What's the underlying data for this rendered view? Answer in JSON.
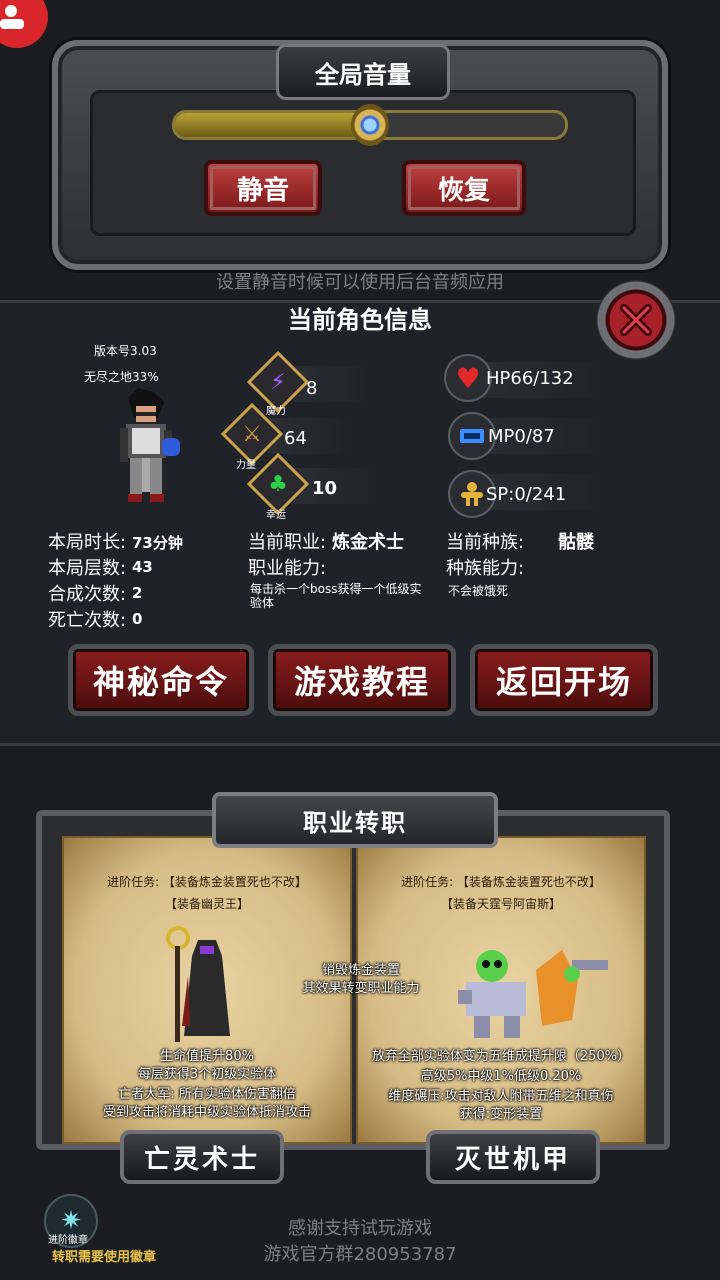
{
  "volume": {
    "title": "全局音量",
    "level_fraction": 0.5,
    "mute_label": "静音",
    "restore_label": "恢复",
    "hint": "设置静音时候可以使用后台音频应用"
  },
  "info": {
    "title": "当前角色信息",
    "version": "版本号3.03",
    "mode": "无尽之地33%",
    "stats": {
      "magic": {
        "label": "魔力",
        "value": "8"
      },
      "power": {
        "label": "力量",
        "value": "64"
      },
      "luck": {
        "label": "幸运",
        "value": "10"
      }
    },
    "hp": "HP66/132",
    "mp": "MP0/87",
    "sp": "SP:0/241",
    "left_rows": [
      {
        "label": "本局时长:",
        "value": "73分钟"
      },
      {
        "label": "本局层数:",
        "value": "43"
      },
      {
        "label": "合成次数:",
        "value": "2"
      },
      {
        "label": "死亡次数:",
        "value": "0"
      }
    ],
    "job_label": "当前职业:",
    "job_value": "炼金术士",
    "job_ability_label": "职业能力:",
    "job_ability_desc": "每击杀一个boss获得一个低级实验体",
    "race_label": "当前种族:",
    "race_value": "骷髅",
    "race_ability_label": "种族能力:",
    "race_ability_desc": "不会被饿死"
  },
  "buttons": {
    "secret": "神秘命令",
    "tutorial": "游戏教程",
    "back": "返回开场"
  },
  "class_change": {
    "title": "职业转职",
    "center_note_1": "销毁炼金装置",
    "center_note_2": "其效果转变职业能力",
    "left": {
      "task_1": "进阶任务: 【装备炼金装置死也不改】",
      "task_2": "【装备幽灵王】",
      "lines": [
        "生命值提升80%",
        "每层获得3个初级实验体",
        "亡者大军: 所有实验体伤害翻倍",
        "受到攻击将消耗中级实验体抵消攻击"
      ],
      "name": "亡灵术士"
    },
    "right": {
      "task_1": "进阶任务: 【装备炼金装置死也不改】",
      "task_2": "【装备天霆号阿宙斯】",
      "lines": [
        "放弃全部实验体变为五维成提升限（250%）",
        "高级5%中级1%低级0.20%",
        "维度碾压:攻击对敌人附带五维之和真伤",
        "获得:变形装置"
      ],
      "name": "灭世机甲"
    }
  },
  "badge": {
    "label": "进阶徽章",
    "note": "转职需要使用徽章"
  },
  "footer": {
    "line1": "感谢支持试玩游戏",
    "line2": "游戏官方群280953787"
  },
  "colors": {
    "accent_red": "#8b1d1d",
    "gold": "#c9a24a",
    "hint_gray": "#7c7f86"
  }
}
